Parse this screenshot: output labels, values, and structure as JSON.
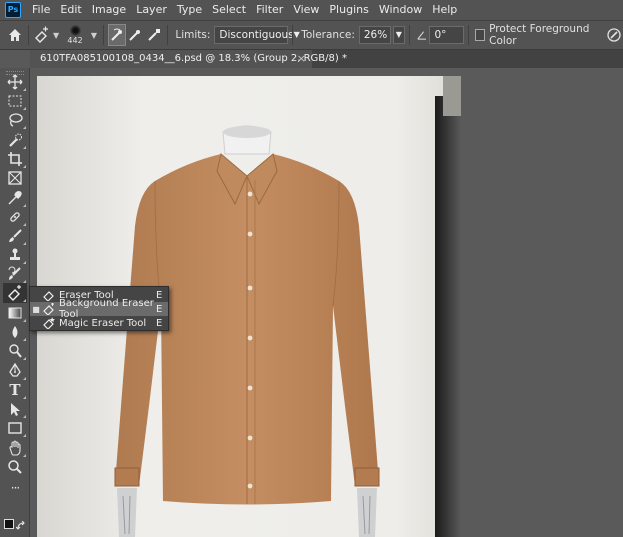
{
  "app": {
    "logo_text": "Ps"
  },
  "menu": [
    "File",
    "Edit",
    "Image",
    "Layer",
    "Type",
    "Select",
    "Filter",
    "View",
    "Plugins",
    "Window",
    "Help"
  ],
  "options": {
    "brush_size": "442",
    "limits_label": "Limits:",
    "limits_value": "Discontiguous",
    "tolerance_label": "Tolerance:",
    "tolerance_value": "26%",
    "angle_value": "0°",
    "protect_label": "Protect Foreground Color",
    "protect_checked": false
  },
  "document": {
    "tab_title": "610TFA085100108_0434__6.psd @ 18.3% (Group 2, RGB/8) *",
    "close_symbol": "×"
  },
  "toolbar": {
    "tools": [
      "move-tool-icon",
      "marquee-tool-icon",
      "lasso-tool-icon",
      "quick-selection-tool-icon",
      "crop-tool-icon",
      "frame-tool-icon",
      "eyedropper-tool-icon",
      "spot-healing-tool-icon",
      "brush-tool-icon",
      "clone-stamp-tool-icon",
      "history-brush-tool-icon",
      "eraser-tool-icon",
      "gradient-tool-icon",
      "blur-tool-icon",
      "dodge-tool-icon",
      "pen-tool-icon",
      "type-tool-icon",
      "path-selection-tool-icon",
      "rectangle-tool-icon",
      "hand-tool-icon",
      "zoom-tool-icon",
      "more-tools-icon",
      "color-swatches-icon"
    ],
    "selected_tool": "eraser-tool-icon",
    "type_tool_glyph": "T",
    "more_tools_glyph": "···"
  },
  "flyout": {
    "items": [
      {
        "label": "Eraser Tool",
        "shortcut": "E",
        "active": false,
        "highlighted": false
      },
      {
        "label": "Background Eraser Tool",
        "shortcut": "E",
        "active": true,
        "highlighted": true
      },
      {
        "label": "Magic Eraser Tool",
        "shortcut": "E",
        "active": false,
        "highlighted": false
      }
    ],
    "active_marker": "■"
  },
  "colors": {
    "ui_dark": "#535353",
    "shirt": "#c08a5f",
    "backdrop": "#eeeeea",
    "highlight": "#6b6b6b"
  }
}
